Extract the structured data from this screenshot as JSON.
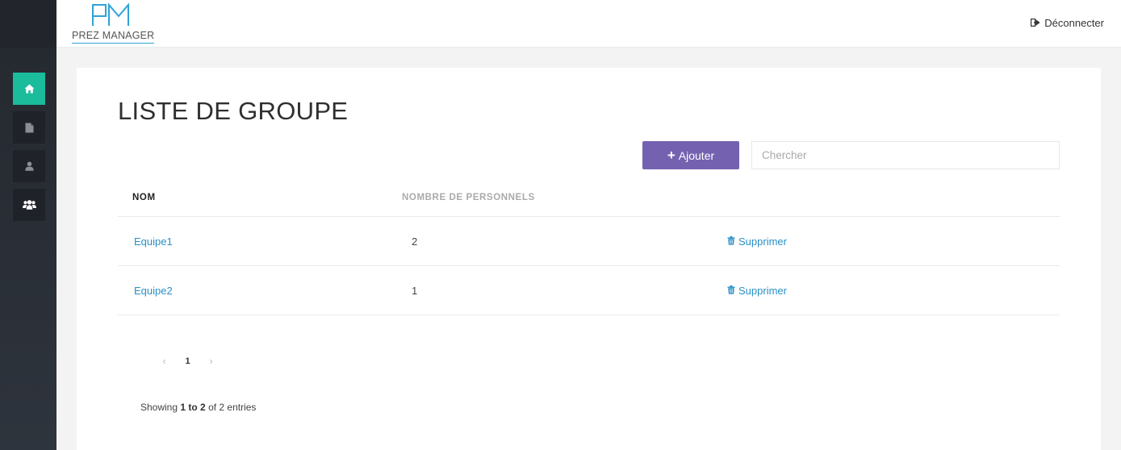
{
  "app": {
    "logo_text": "PREZ MANAGER",
    "logo_mark": "PM"
  },
  "header": {
    "logout_label": "Déconnecter",
    "logout_icon": "sign-out-icon"
  },
  "sidebar": {
    "items": [
      {
        "icon": "home-icon",
        "active": true
      },
      {
        "icon": "file-icon",
        "active": false
      },
      {
        "icon": "user-icon",
        "active": false
      },
      {
        "icon": "users-icon",
        "active": false
      }
    ],
    "active_color": "#1abc9c"
  },
  "main": {
    "title": "LISTE DE GROUPE",
    "add_button_label": "Ajouter",
    "search_placeholder": "Chercher",
    "search_value": "",
    "table": {
      "columns": [
        "NOM",
        "NOMBRE DE PERSONNELS"
      ],
      "rows": [
        {
          "name": "Equipe1",
          "count": "2",
          "action": "Supprimer"
        },
        {
          "name": "Equipe2",
          "count": "1",
          "action": "Supprimer"
        }
      ]
    },
    "pagination": {
      "prev": "‹",
      "current": "1",
      "next": "›"
    },
    "entries": {
      "prefix": "Showing",
      "range": "1 to 2",
      "suffix": "of 2 entries"
    }
  },
  "colors": {
    "accent_button": "#7462b0",
    "link": "#2a8fc7"
  }
}
